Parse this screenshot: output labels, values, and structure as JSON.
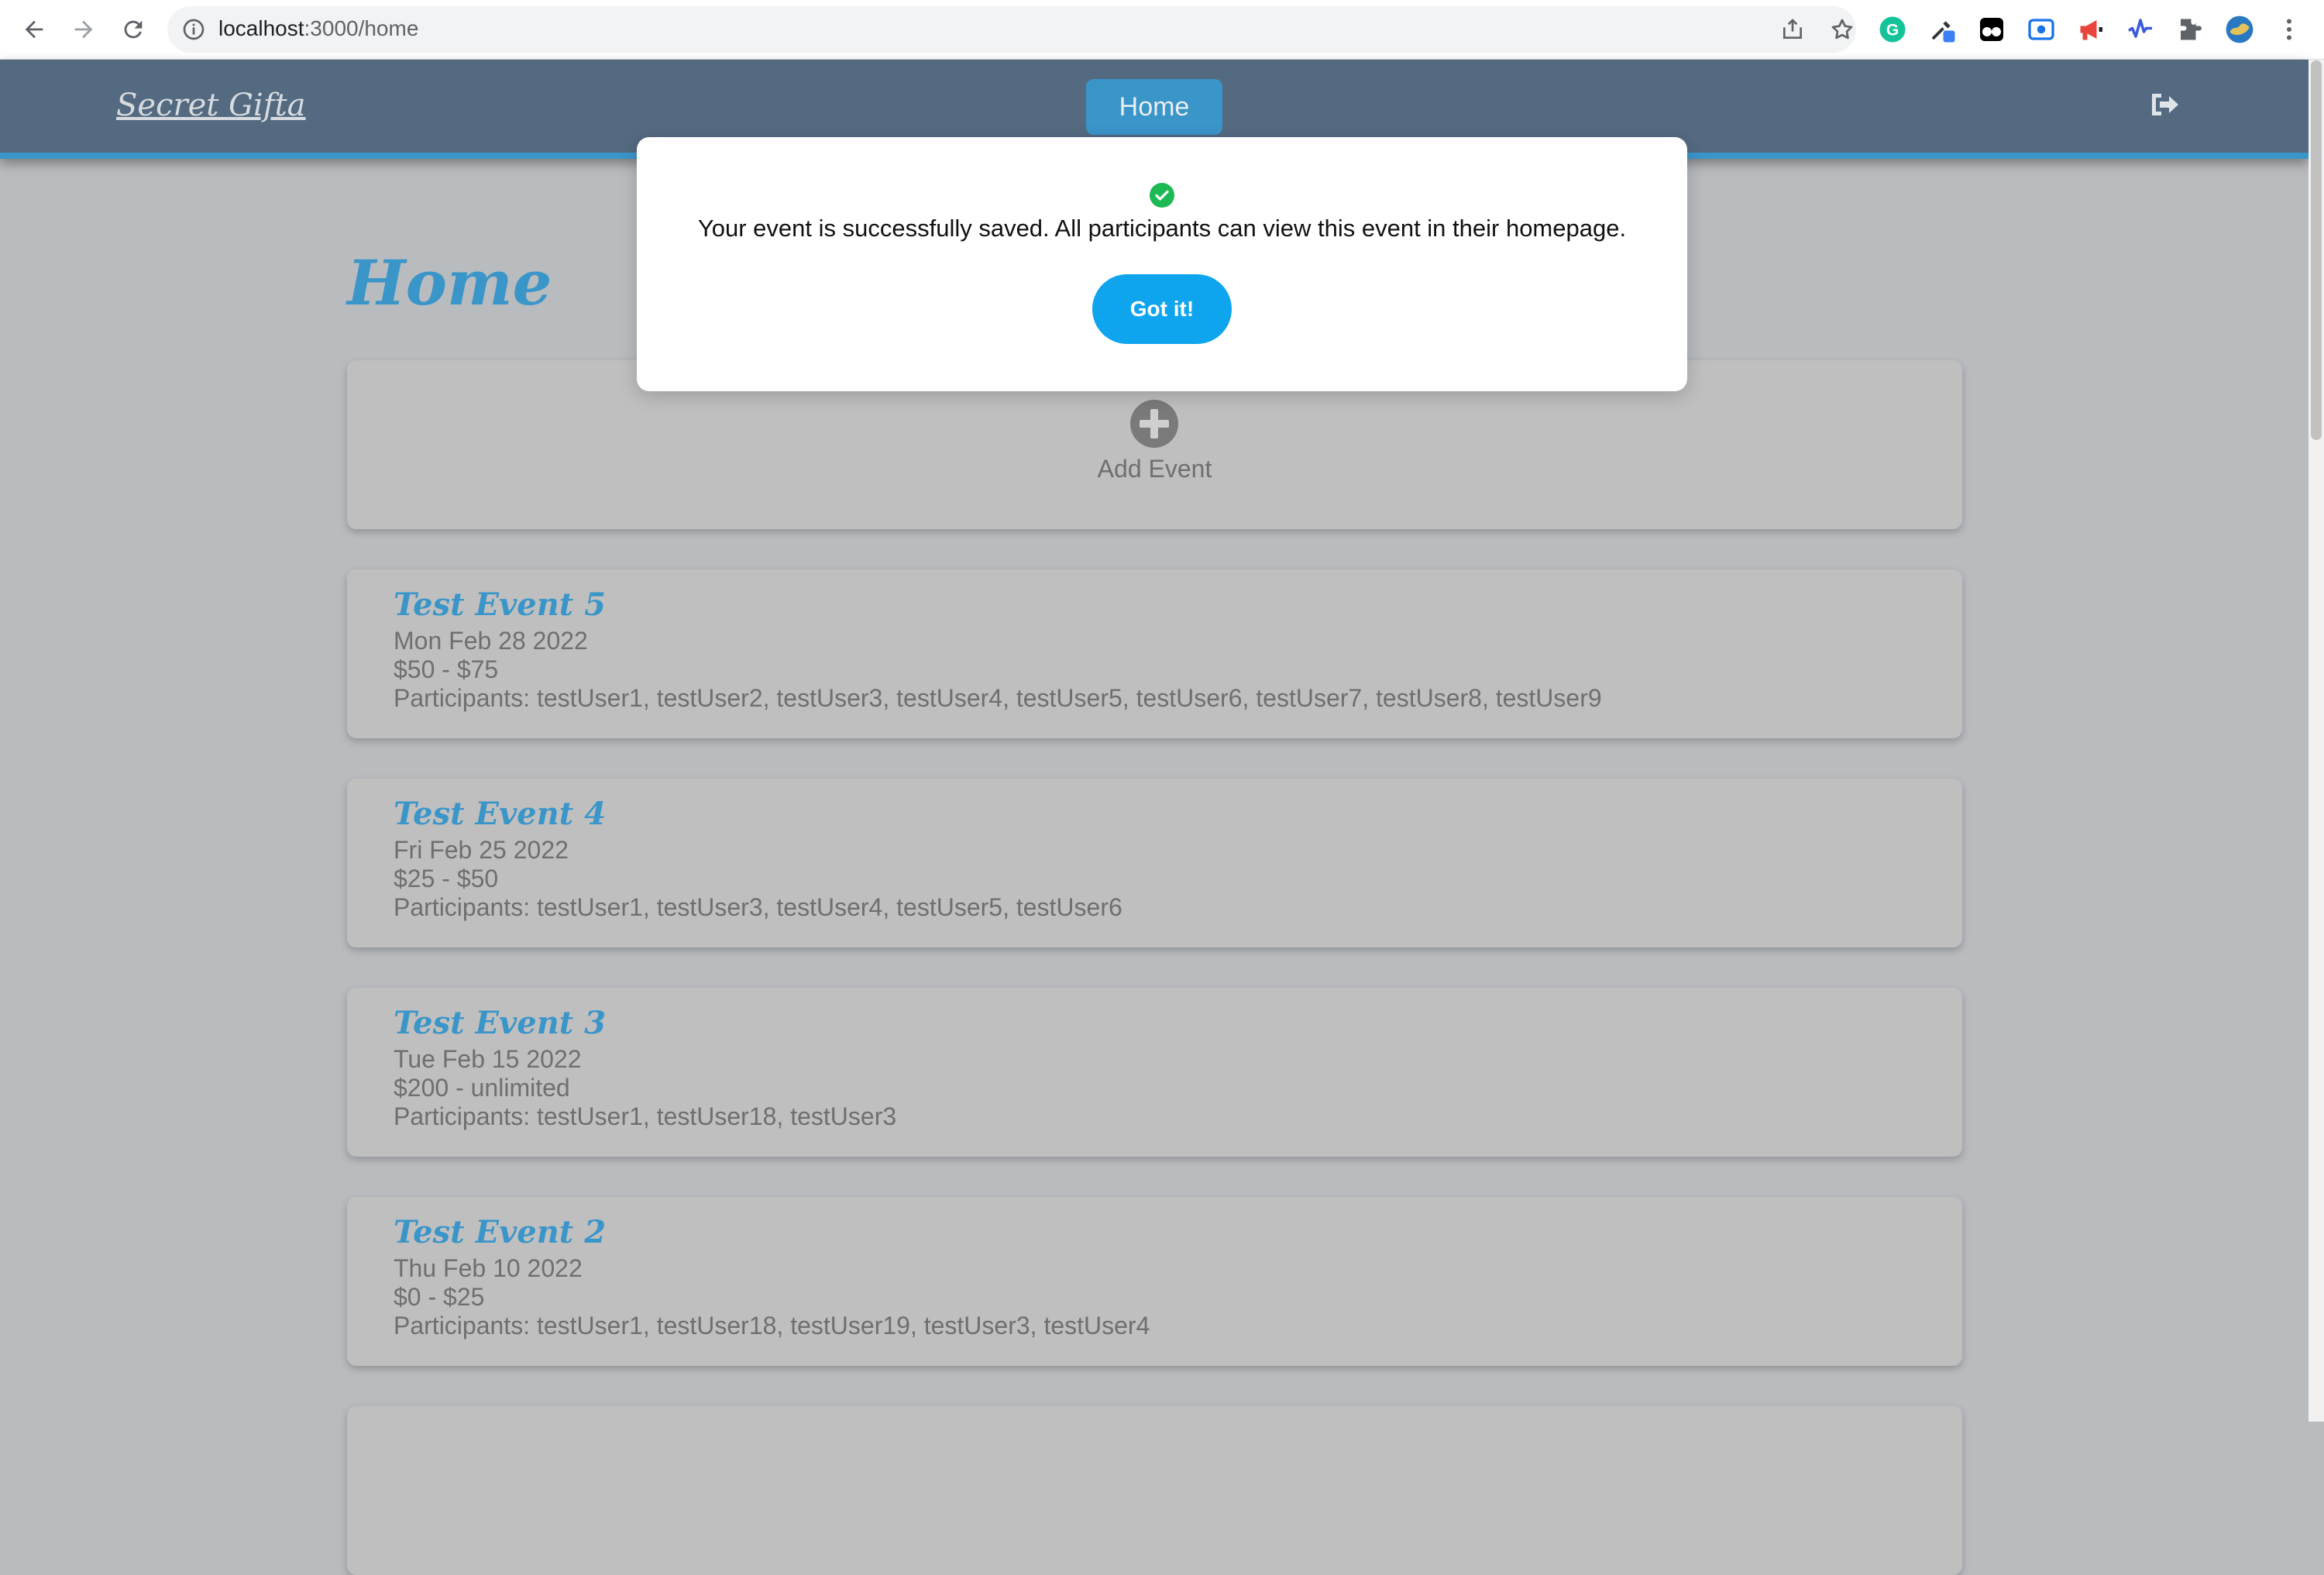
{
  "browser": {
    "url_host": "localhost",
    "url_path": ":3000/home"
  },
  "navbar": {
    "brand": "Secret Gifta",
    "home_tab": "Home"
  },
  "page": {
    "title": "Home",
    "add_event_label": "Add Event"
  },
  "events": [
    {
      "title": "Test Event 5",
      "date": "Mon Feb 28 2022",
      "budget": "$50 - $75",
      "participants": "Participants: testUser1, testUser2, testUser3, testUser4, testUser5, testUser6, testUser7, testUser8, testUser9"
    },
    {
      "title": "Test Event 4",
      "date": "Fri Feb 25 2022",
      "budget": "$25 - $50",
      "participants": "Participants: testUser1, testUser3, testUser4, testUser5, testUser6"
    },
    {
      "title": "Test Event 3",
      "date": "Tue Feb 15 2022",
      "budget": "$200 - unlimited",
      "participants": "Participants: testUser1, testUser18, testUser3"
    },
    {
      "title": "Test Event 2",
      "date": "Thu Feb 10 2022",
      "budget": "$0 - $25",
      "participants": "Participants: testUser1, testUser18, testUser19, testUser3, testUser4"
    }
  ],
  "modal": {
    "message": "Your event is successfully saved. All participants can view this event in their homepage.",
    "button_label": "Got it!"
  },
  "colors": {
    "accent": "#3a95c9",
    "navbar": "#546a81",
    "overlay_bg": "#b9bcbf",
    "card": "#bfbfbf",
    "button": "#0fa5ee",
    "success": "#1db954"
  }
}
